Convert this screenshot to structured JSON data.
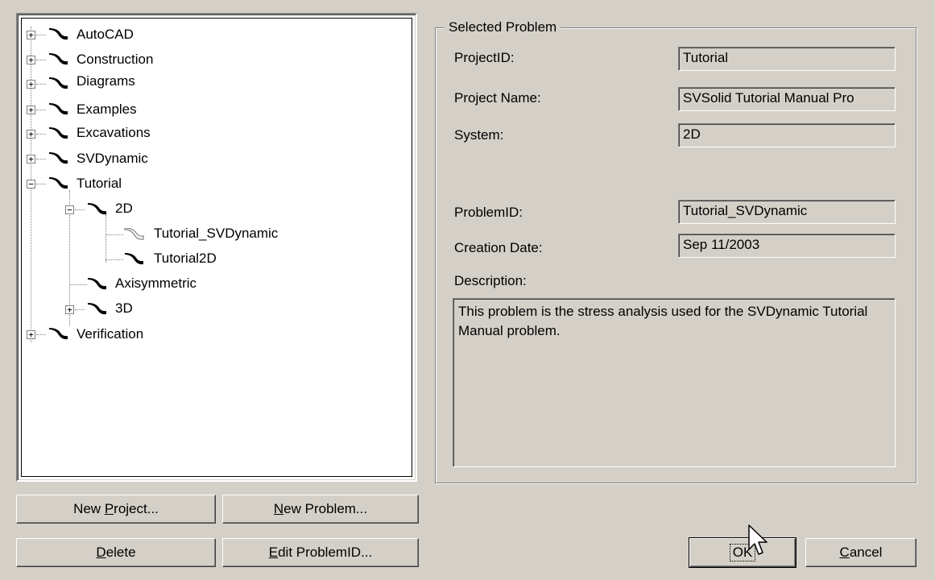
{
  "tree": {
    "items": [
      {
        "label": "AutoCAD",
        "expander": "+"
      },
      {
        "label": "Construction",
        "expander": "+"
      },
      {
        "label": "Diagrams",
        "expander": "+"
      },
      {
        "label": "Examples",
        "expander": "+"
      },
      {
        "label": "Excavations",
        "expander": "+"
      },
      {
        "label": "SVDynamic",
        "expander": "+"
      },
      {
        "label": "Tutorial",
        "expander": "−"
      },
      {
        "label": "2D",
        "expander": "−"
      },
      {
        "label": "Tutorial_SVDynamic"
      },
      {
        "label": "Tutorial2D"
      },
      {
        "label": "Axisymmetric"
      },
      {
        "label": "3D",
        "expander": "+"
      },
      {
        "label": "Verification",
        "expander": "+"
      }
    ]
  },
  "selected_problem": {
    "legend": "Selected Problem",
    "project_id_label": "ProjectID:",
    "project_id_value": "Tutorial",
    "project_name_label": "Project Name:",
    "project_name_value": "SVSolid Tutorial Manual Pro",
    "system_label": "System:",
    "system_value": "2D",
    "problem_id_label": "ProblemID:",
    "problem_id_value": "Tutorial_SVDynamic",
    "creation_date_label": "Creation Date:",
    "creation_date_value": "Sep 11/2003",
    "description_label": "Description:",
    "description_value": "This problem is the stress analysis used for the SVDynamic Tutorial Manual problem."
  },
  "buttons": {
    "new_project": {
      "pre": "New ",
      "accel": "P",
      "post": "roject..."
    },
    "new_problem": {
      "pre": "",
      "accel": "N",
      "post": "ew Problem..."
    },
    "delete": {
      "pre": "",
      "accel": "D",
      "post": "elete"
    },
    "edit_problem_id": {
      "pre": "",
      "accel": "E",
      "post": "dit ProblemID..."
    },
    "ok": "OK",
    "cancel": {
      "pre": "",
      "accel": "C",
      "post": "ancel"
    }
  },
  "icons": {
    "tree_item": "curve-icon",
    "tree_item_selected": "curve-icon-faded",
    "cursor": "arrow-cursor-icon"
  }
}
